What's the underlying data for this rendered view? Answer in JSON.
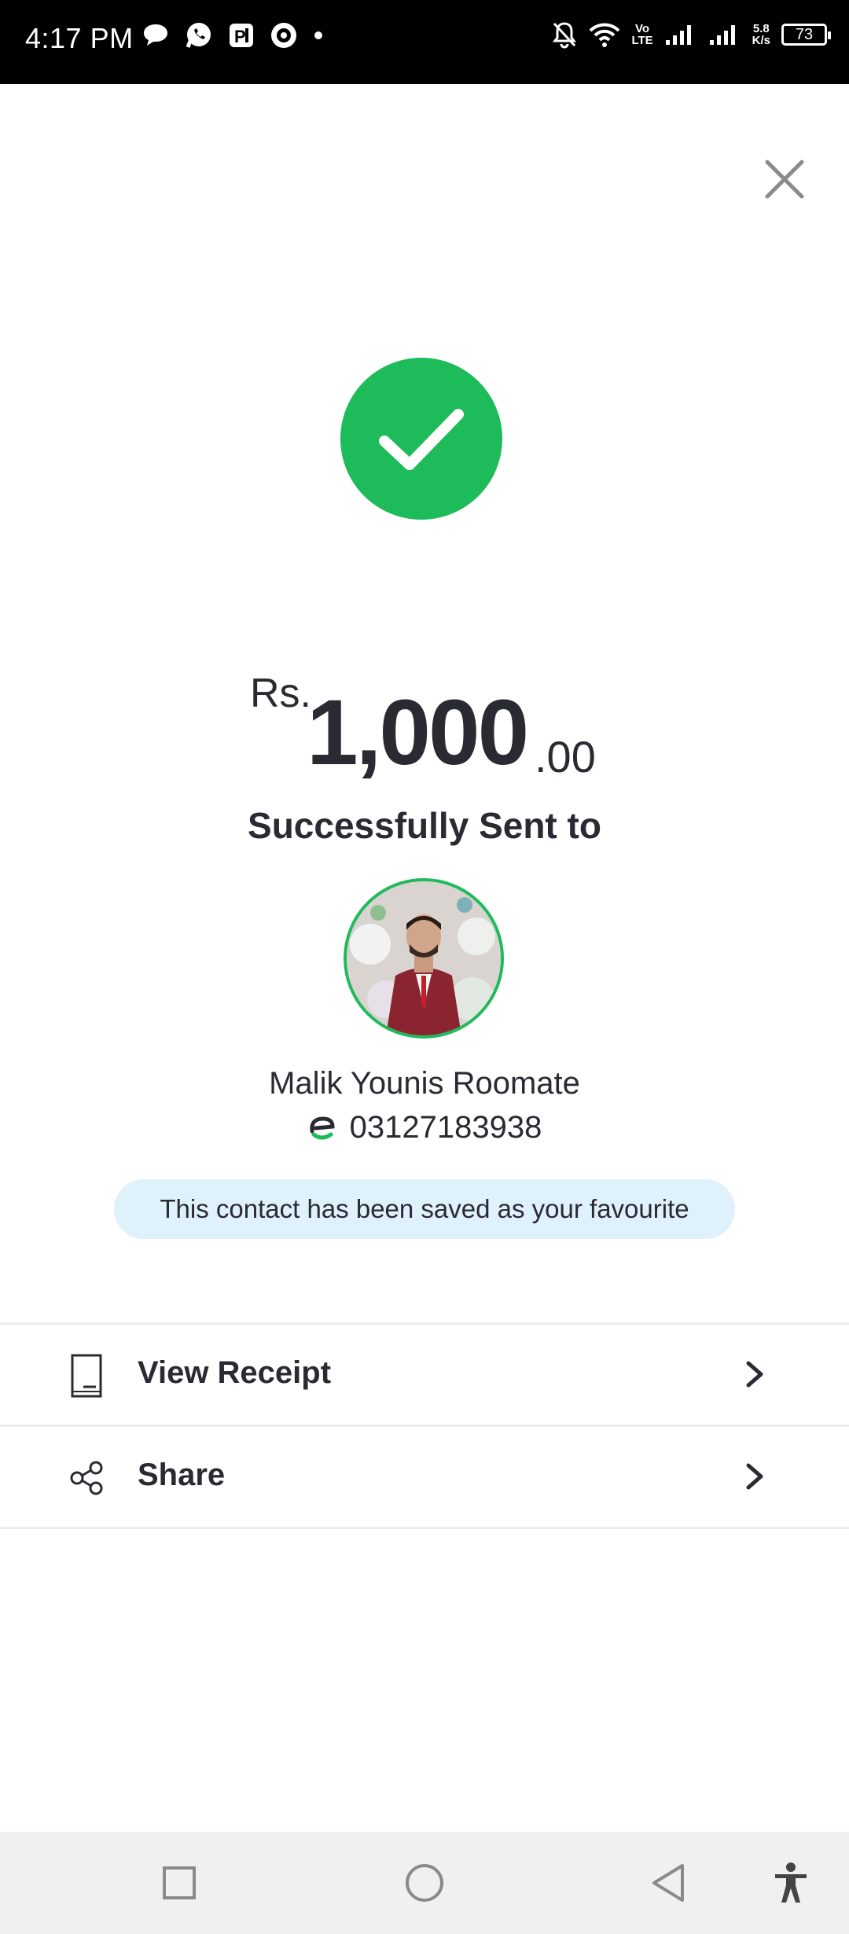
{
  "status_bar": {
    "time": "4:17 PM",
    "left_icons": [
      "chat-bubble-icon",
      "whatsapp-icon",
      "app-p-icon",
      "vpn-globe-icon",
      "dot-icon"
    ],
    "network_label_top": "Vo",
    "network_label_bottom": "LTE",
    "speed_top": "5.8",
    "speed_bottom": "K/s",
    "battery": "73"
  },
  "header": {
    "close_icon": "close-icon"
  },
  "transaction": {
    "status_icon": "check-icon",
    "status_color": "#1dbb5a",
    "currency": "Rs.",
    "amount_main": "1,000",
    "amount_decimals": ".00",
    "message": "Successfully Sent to"
  },
  "recipient": {
    "name": "Malik Younis Roomate",
    "wallet_icon": "easypaisa-icon",
    "number": "03127183938"
  },
  "favourite_notice": "This contact has been saved as your favourite",
  "actions": [
    {
      "icon": "receipt-icon",
      "label": "View Receipt"
    },
    {
      "icon": "share-icon",
      "label": "Share"
    }
  ],
  "navigation": [
    "recents-square-icon",
    "home-circle-icon",
    "back-triangle-icon",
    "accessibility-icon"
  ]
}
